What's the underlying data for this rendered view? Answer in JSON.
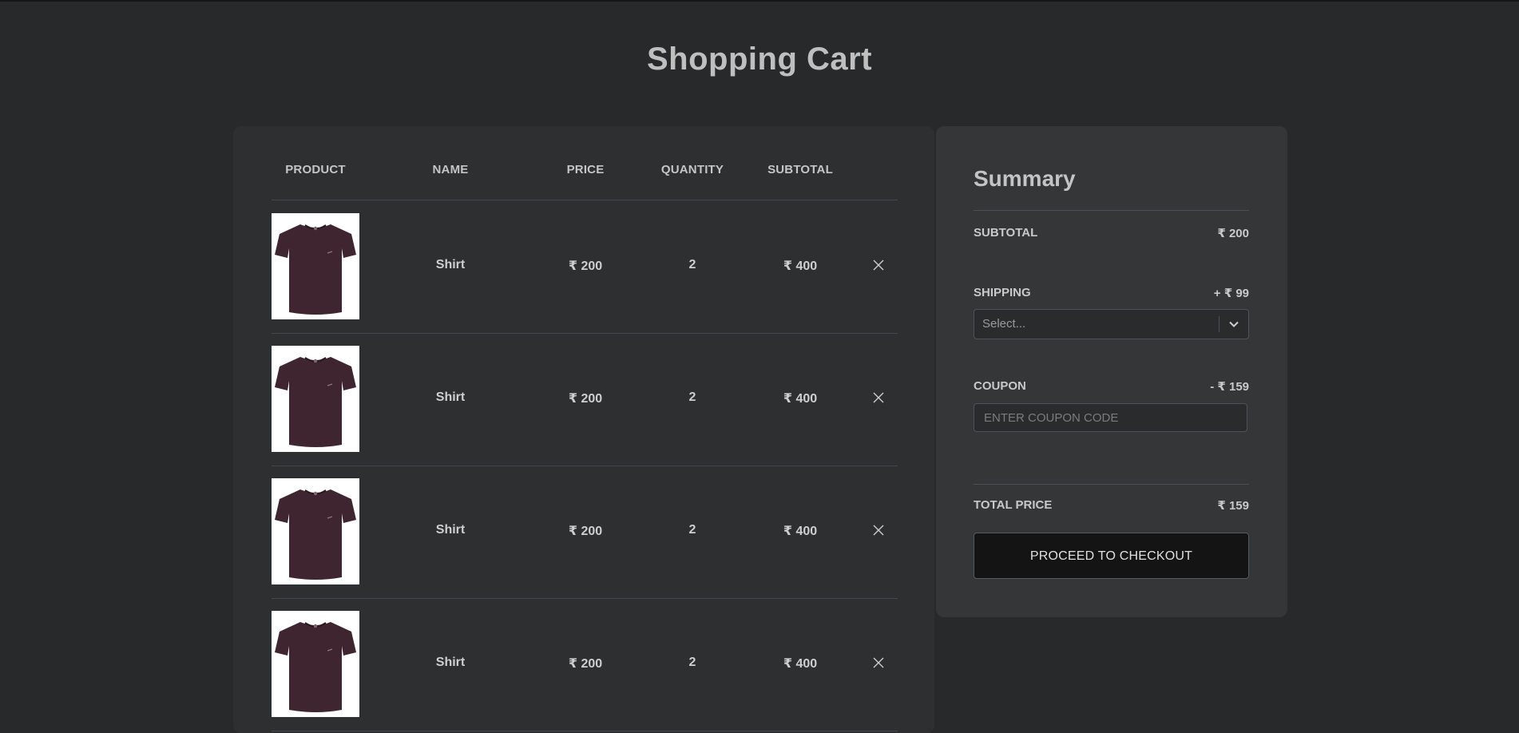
{
  "page": {
    "title": "Shopping Cart"
  },
  "cart": {
    "headers": {
      "product": "PRODUCT",
      "name": "NAME",
      "price": "PRICE",
      "quantity": "QUANTITY",
      "subtotal": "SUBTOTAL"
    },
    "items": [
      {
        "name": "Shirt",
        "price": "₹ 200",
        "quantity": "2",
        "subtotal": "₹ 400",
        "image": "shirt-image",
        "remove_icon": "close-icon"
      },
      {
        "name": "Shirt",
        "price": "₹ 200",
        "quantity": "2",
        "subtotal": "₹ 400",
        "image": "shirt-image",
        "remove_icon": "close-icon"
      },
      {
        "name": "Shirt",
        "price": "₹ 200",
        "quantity": "2",
        "subtotal": "₹ 400",
        "image": "shirt-image",
        "remove_icon": "close-icon"
      },
      {
        "name": "Shirt",
        "price": "₹ 200",
        "quantity": "2",
        "subtotal": "₹ 400",
        "image": "shirt-image",
        "remove_icon": "close-icon"
      }
    ]
  },
  "summary": {
    "title": "Summary",
    "subtotal_label": "SUBTOTAL",
    "subtotal_value": "₹ 200",
    "shipping_label": "SHIPPING",
    "shipping_value": "+ ₹ 99",
    "shipping_select_placeholder": "Select...",
    "coupon_label": "COUPON",
    "coupon_value": "- ₹ 159",
    "coupon_placeholder": "ENTER COUPON CODE",
    "coupon_input_value": "",
    "total_label": "TOTAL PRICE",
    "total_value": "₹ 159",
    "checkout_label": "PROCEED TO CHECKOUT"
  },
  "colors": {
    "background": "#28292b",
    "cart_panel": "#2e2f31",
    "summary_panel": "#343638",
    "checkout_button": "#141414",
    "shirt": "#3f2530"
  }
}
